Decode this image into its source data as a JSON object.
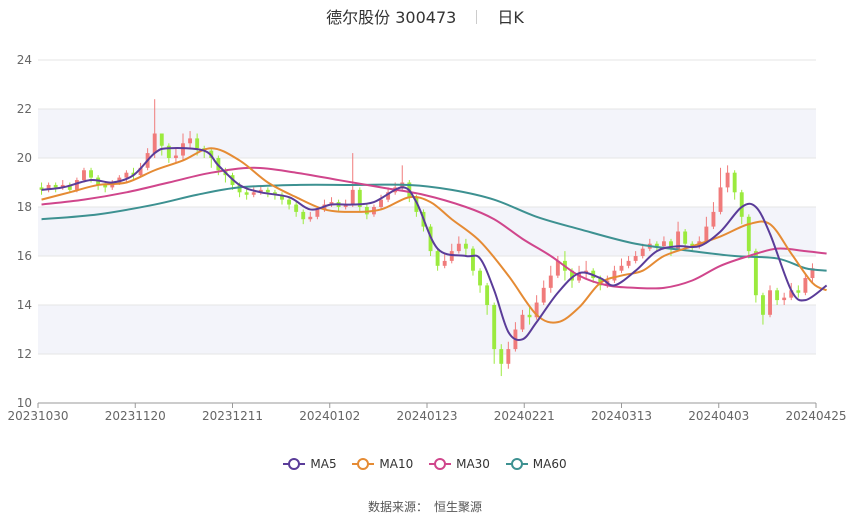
{
  "header": {
    "stock_name": "德尔股份 300473",
    "period": "日K"
  },
  "source": {
    "label": "数据来源：",
    "name": "恒生聚源"
  },
  "colors": {
    "up": "#f07b7b",
    "down": "#9bea3e",
    "ma5": "#5a3c99",
    "ma10": "#e58b34",
    "ma30": "#d0468c",
    "ma60": "#3d9191",
    "band": "#f3f4fa",
    "grid": "#e6e6e6"
  },
  "chart_data": {
    "type": "candlestick",
    "title": "德尔股份 300473 日K",
    "ylim": [
      10,
      24
    ],
    "yticks": [
      10,
      12,
      14,
      16,
      18,
      20,
      22,
      24
    ],
    "x_tick_labels": [
      "20231030",
      "20231120",
      "20231211",
      "20240102",
      "20240123",
      "20240221",
      "20240313",
      "20240403",
      "20240425"
    ],
    "legend": [
      "MA5",
      "MA10",
      "MA30",
      "MA60"
    ],
    "legend_position": "bottom",
    "candles": [
      [
        18.8,
        18.7,
        19.0,
        18.5
      ],
      [
        18.7,
        18.9,
        19.0,
        18.6
      ],
      [
        18.9,
        18.8,
        19.0,
        18.6
      ],
      [
        18.8,
        18.9,
        19.1,
        18.7
      ],
      [
        18.9,
        18.7,
        19.0,
        18.6
      ],
      [
        18.7,
        19.1,
        19.2,
        18.6
      ],
      [
        19.1,
        19.5,
        19.6,
        19.0
      ],
      [
        19.5,
        19.2,
        19.6,
        19.0
      ],
      [
        19.2,
        18.9,
        19.3,
        18.7
      ],
      [
        18.9,
        18.8,
        19.0,
        18.6
      ],
      [
        18.8,
        19.0,
        19.1,
        18.7
      ],
      [
        19.0,
        19.2,
        19.3,
        18.9
      ],
      [
        19.2,
        19.4,
        19.5,
        19.0
      ],
      [
        19.4,
        19.3,
        19.6,
        19.1
      ],
      [
        19.3,
        19.6,
        19.8,
        19.2
      ],
      [
        19.6,
        20.2,
        20.4,
        19.5
      ],
      [
        20.2,
        21.0,
        22.4,
        20.0
      ],
      [
        21.0,
        20.5,
        21.0,
        20.1
      ],
      [
        20.5,
        20.0,
        20.6,
        19.8
      ],
      [
        20.0,
        20.1,
        20.4,
        19.8
      ],
      [
        20.1,
        20.6,
        21.0,
        19.9
      ],
      [
        20.6,
        20.8,
        21.1,
        20.4
      ],
      [
        20.8,
        20.4,
        21.0,
        20.1
      ],
      [
        20.4,
        20.3,
        20.5,
        20.0
      ],
      [
        20.3,
        20.0,
        20.4,
        19.6
      ],
      [
        20.0,
        19.5,
        20.1,
        19.3
      ],
      [
        19.5,
        19.3,
        19.6,
        19.0
      ],
      [
        19.3,
        18.9,
        19.4,
        18.7
      ],
      [
        18.9,
        18.6,
        19.0,
        18.4
      ],
      [
        18.6,
        18.5,
        18.8,
        18.3
      ],
      [
        18.5,
        18.6,
        18.8,
        18.4
      ],
      [
        18.6,
        18.7,
        18.9,
        18.5
      ],
      [
        18.7,
        18.6,
        18.8,
        18.4
      ],
      [
        18.6,
        18.5,
        18.7,
        18.3
      ],
      [
        18.5,
        18.3,
        18.6,
        18.1
      ],
      [
        18.3,
        18.1,
        18.4,
        17.9
      ],
      [
        18.1,
        17.8,
        18.2,
        17.6
      ],
      [
        17.8,
        17.5,
        17.9,
        17.3
      ],
      [
        17.5,
        17.6,
        17.8,
        17.4
      ],
      [
        17.6,
        17.9,
        18.0,
        17.5
      ],
      [
        17.9,
        18.1,
        18.3,
        17.8
      ],
      [
        18.1,
        18.2,
        18.4,
        18.0
      ],
      [
        18.2,
        18.0,
        18.3,
        17.8
      ],
      [
        18.0,
        18.1,
        18.3,
        17.9
      ],
      [
        18.1,
        18.7,
        20.2,
        18.0
      ],
      [
        18.7,
        18.0,
        18.8,
        17.8
      ],
      [
        18.0,
        17.7,
        18.1,
        17.5
      ],
      [
        17.7,
        18.0,
        18.1,
        17.6
      ],
      [
        18.0,
        18.3,
        18.5,
        17.9
      ],
      [
        18.3,
        18.6,
        18.8,
        18.2
      ],
      [
        18.6,
        18.8,
        19.0,
        18.5
      ],
      [
        18.8,
        19.0,
        19.7,
        18.7
      ],
      [
        19.0,
        18.4,
        19.1,
        18.2
      ],
      [
        18.4,
        17.8,
        18.5,
        17.6
      ],
      [
        17.8,
        17.2,
        17.9,
        17.0
      ],
      [
        17.2,
        16.2,
        17.3,
        16.0
      ],
      [
        16.2,
        15.6,
        16.3,
        15.4
      ],
      [
        15.6,
        15.8,
        16.1,
        15.5
      ],
      [
        15.8,
        16.2,
        16.5,
        15.7
      ],
      [
        16.2,
        16.5,
        16.8,
        16.1
      ],
      [
        16.5,
        16.3,
        16.7,
        16.0
      ],
      [
        16.3,
        15.4,
        16.4,
        15.2
      ],
      [
        15.4,
        14.8,
        15.5,
        14.5
      ],
      [
        14.8,
        14.0,
        14.9,
        13.6
      ],
      [
        14.0,
        12.2,
        14.1,
        11.6
      ],
      [
        12.2,
        11.6,
        12.4,
        11.1
      ],
      [
        11.6,
        12.2,
        12.5,
        11.4
      ],
      [
        12.2,
        13.0,
        13.3,
        12.1
      ],
      [
        13.0,
        13.6,
        13.8,
        12.9
      ],
      [
        13.6,
        13.5,
        13.9,
        13.2
      ],
      [
        13.5,
        14.1,
        14.4,
        13.4
      ],
      [
        14.1,
        14.7,
        15.0,
        14.0
      ],
      [
        14.7,
        15.2,
        15.6,
        14.5
      ],
      [
        15.2,
        15.8,
        16.0,
        15.1
      ],
      [
        15.8,
        15.4,
        16.2,
        15.0
      ],
      [
        15.4,
        15.0,
        15.5,
        14.7
      ],
      [
        15.0,
        15.3,
        15.6,
        14.9
      ],
      [
        15.3,
        15.4,
        15.8,
        15.1
      ],
      [
        15.4,
        15.1,
        15.5,
        14.9
      ],
      [
        15.1,
        14.8,
        15.2,
        14.6
      ],
      [
        14.8,
        15.0,
        15.2,
        14.7
      ],
      [
        15.0,
        15.4,
        15.6,
        14.9
      ],
      [
        15.4,
        15.6,
        15.9,
        15.3
      ],
      [
        15.6,
        15.8,
        16.0,
        15.5
      ],
      [
        15.8,
        16.0,
        16.2,
        15.7
      ],
      [
        16.0,
        16.3,
        16.5,
        15.9
      ],
      [
        16.3,
        16.5,
        16.7,
        16.2
      ],
      [
        16.5,
        16.4,
        16.6,
        16.2
      ],
      [
        16.4,
        16.6,
        16.8,
        16.3
      ],
      [
        16.6,
        16.3,
        16.7,
        16.0
      ],
      [
        16.3,
        17.0,
        17.4,
        16.2
      ],
      [
        17.0,
        16.5,
        17.1,
        16.3
      ],
      [
        16.5,
        16.4,
        16.6,
        16.2
      ],
      [
        16.4,
        16.6,
        16.8,
        16.3
      ],
      [
        16.6,
        17.2,
        17.6,
        16.5
      ],
      [
        17.2,
        17.8,
        18.2,
        17.1
      ],
      [
        17.8,
        18.8,
        19.6,
        17.7
      ],
      [
        18.8,
        19.4,
        19.7,
        18.6
      ],
      [
        19.4,
        18.6,
        19.5,
        18.3
      ],
      [
        18.6,
        17.6,
        18.7,
        17.3
      ],
      [
        17.6,
        16.2,
        17.7,
        15.9
      ],
      [
        16.2,
        14.4,
        16.3,
        14.1
      ],
      [
        14.4,
        13.6,
        14.5,
        13.2
      ],
      [
        13.6,
        14.6,
        14.8,
        13.5
      ],
      [
        14.6,
        14.2,
        14.7,
        14.0
      ],
      [
        14.2,
        14.3,
        14.5,
        14.0
      ],
      [
        14.3,
        14.6,
        14.9,
        14.2
      ],
      [
        14.6,
        14.5,
        14.8,
        14.3
      ],
      [
        14.5,
        15.1,
        15.3,
        14.4
      ],
      [
        15.1,
        15.5,
        15.7,
        14.9
      ]
    ],
    "moving_averages": {
      "MA5": [
        [
          0,
          18.7
        ],
        [
          3,
          18.8
        ],
        [
          7,
          19.1
        ],
        [
          10,
          19.0
        ],
        [
          13,
          19.3
        ],
        [
          16,
          20.2
        ],
        [
          18,
          20.4
        ],
        [
          23,
          20.3
        ],
        [
          25,
          19.7
        ],
        [
          28,
          18.9
        ],
        [
          31,
          18.6
        ],
        [
          35,
          18.4
        ],
        [
          38,
          17.9
        ],
        [
          41,
          18.1
        ],
        [
          44,
          18.1
        ],
        [
          47,
          18.2
        ],
        [
          51,
          18.8
        ],
        [
          53,
          18.2
        ],
        [
          56,
          16.3
        ],
        [
          60,
          16.0
        ],
        [
          62,
          15.9
        ],
        [
          64,
          14.6
        ],
        [
          66,
          12.9
        ],
        [
          68,
          12.6
        ],
        [
          70,
          13.3
        ],
        [
          73,
          14.5
        ],
        [
          76,
          15.3
        ],
        [
          79,
          15.1
        ],
        [
          81,
          14.8
        ],
        [
          84,
          15.4
        ],
        [
          87,
          16.2
        ],
        [
          90,
          16.4
        ],
        [
          93,
          16.4
        ],
        [
          96,
          17.0
        ],
        [
          99,
          18.0
        ],
        [
          101,
          18.0
        ],
        [
          103,
          16.9
        ],
        [
          106,
          14.6
        ],
        [
          108,
          14.2
        ],
        [
          111,
          14.8
        ]
      ],
      "MA10": [
        [
          0,
          18.3
        ],
        [
          4,
          18.6
        ],
        [
          8,
          18.9
        ],
        [
          12,
          19.0
        ],
        [
          16,
          19.5
        ],
        [
          20,
          19.9
        ],
        [
          24,
          20.4
        ],
        [
          28,
          19.9
        ],
        [
          32,
          19.0
        ],
        [
          36,
          18.4
        ],
        [
          40,
          17.9
        ],
        [
          44,
          17.8
        ],
        [
          48,
          17.9
        ],
        [
          52,
          18.4
        ],
        [
          55,
          18.2
        ],
        [
          58,
          17.5
        ],
        [
          62,
          16.6
        ],
        [
          66,
          15.2
        ],
        [
          70,
          13.6
        ],
        [
          73,
          13.3
        ],
        [
          76,
          13.9
        ],
        [
          79,
          14.9
        ],
        [
          82,
          15.2
        ],
        [
          85,
          15.4
        ],
        [
          88,
          16.0
        ],
        [
          92,
          16.4
        ],
        [
          96,
          16.8
        ],
        [
          100,
          17.3
        ],
        [
          103,
          17.3
        ],
        [
          106,
          16.1
        ],
        [
          109,
          14.9
        ],
        [
          111,
          14.6
        ]
      ],
      "MA30": [
        [
          0,
          18.1
        ],
        [
          6,
          18.3
        ],
        [
          12,
          18.6
        ],
        [
          18,
          19.0
        ],
        [
          24,
          19.4
        ],
        [
          30,
          19.6
        ],
        [
          36,
          19.4
        ],
        [
          42,
          19.1
        ],
        [
          48,
          18.8
        ],
        [
          54,
          18.5
        ],
        [
          60,
          18.0
        ],
        [
          64,
          17.5
        ],
        [
          68,
          16.7
        ],
        [
          72,
          16.0
        ],
        [
          76,
          15.2
        ],
        [
          80,
          14.8
        ],
        [
          84,
          14.7
        ],
        [
          88,
          14.7
        ],
        [
          92,
          15.0
        ],
        [
          96,
          15.6
        ],
        [
          100,
          16.0
        ],
        [
          104,
          16.3
        ],
        [
          108,
          16.2
        ],
        [
          111,
          16.1
        ]
      ],
      "MA60": [
        [
          0,
          17.5
        ],
        [
          8,
          17.7
        ],
        [
          16,
          18.1
        ],
        [
          22,
          18.5
        ],
        [
          28,
          18.8
        ],
        [
          36,
          18.9
        ],
        [
          44,
          18.9
        ],
        [
          52,
          18.9
        ],
        [
          58,
          18.7
        ],
        [
          64,
          18.3
        ],
        [
          70,
          17.6
        ],
        [
          76,
          17.1
        ],
        [
          84,
          16.5
        ],
        [
          92,
          16.2
        ],
        [
          98,
          16.0
        ],
        [
          104,
          15.9
        ],
        [
          108,
          15.5
        ],
        [
          111,
          15.4
        ]
      ]
    }
  }
}
